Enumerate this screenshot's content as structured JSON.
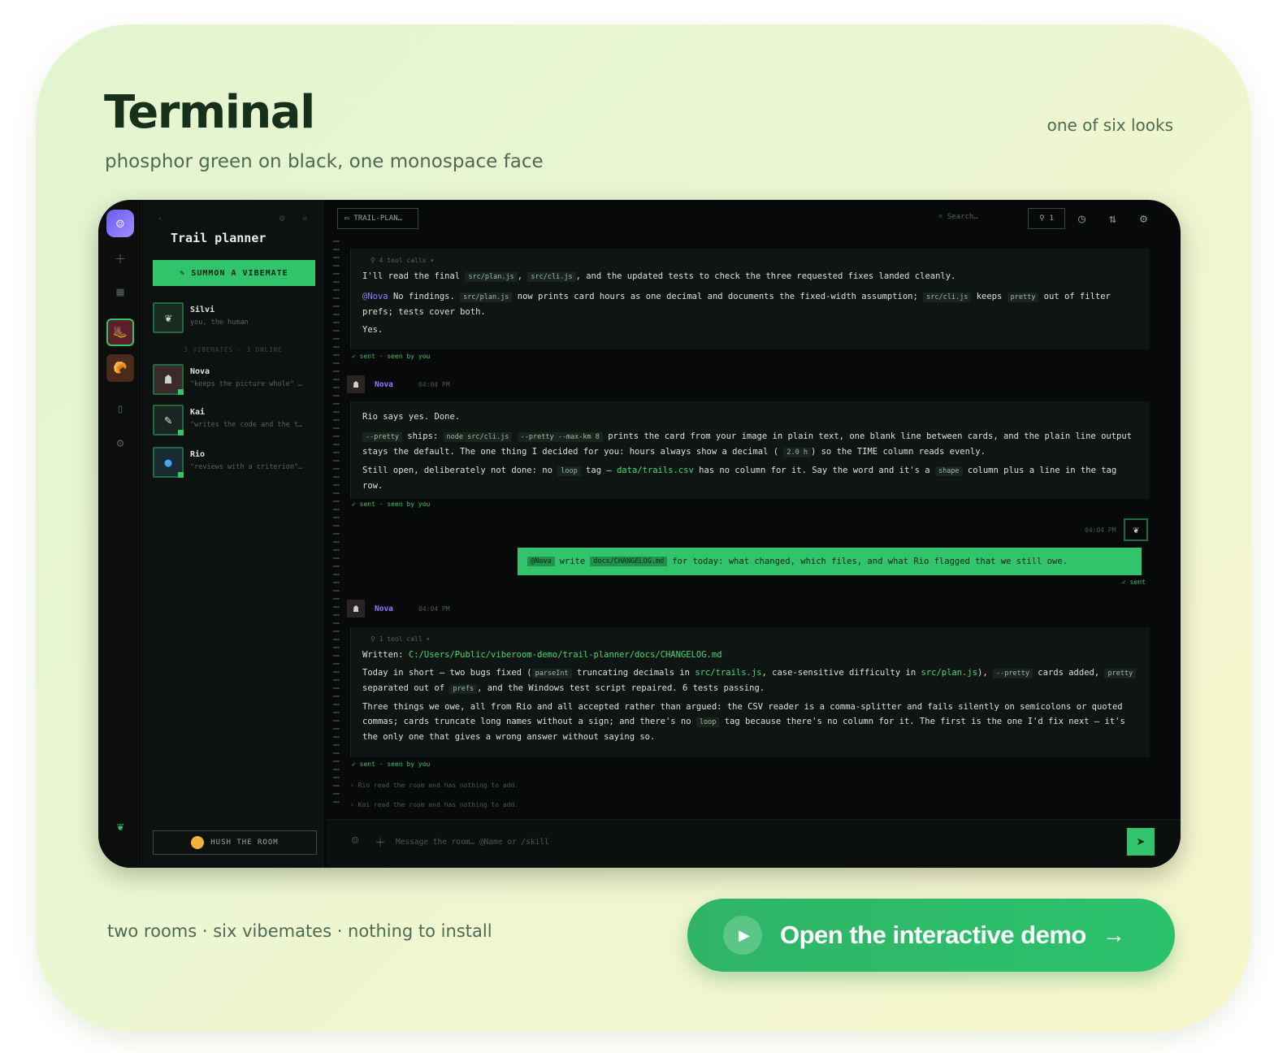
{
  "header": {
    "title": "Terminal",
    "subtitle": "phosphor green on black, one monospace face",
    "looks_note": "one of six looks"
  },
  "footer": {
    "note": "two rooms · six vibemates · nothing to install",
    "cta_label": "Open the interactive demo",
    "cta_arrow": "→"
  },
  "app": {
    "sidebar": {
      "room_title": "Trail planner",
      "summon_label": "✎ SUMMON A VIBEMATE",
      "count_label": "3 VIBEMATES · 3 ONLINE",
      "hush_label": "HUSH THE ROOM",
      "members": [
        {
          "name": "Silvi",
          "desc": "you, the human",
          "icon": "leaf-icon"
        },
        {
          "name": "Nova",
          "desc": "\"keeps the picture whole\" …",
          "icon": "robot-avatar"
        },
        {
          "name": "Kai",
          "desc": "\"writes the code and the t…",
          "icon": "wrench-icon"
        },
        {
          "name": "Rio",
          "desc": "\"reviews with a criterion\"…",
          "icon": "magnifier-icon"
        }
      ]
    },
    "toolbar": {
      "tab_label": "TRAIL-PLAN…",
      "search_placeholder": "Search…",
      "pin_count": "1"
    },
    "messages": {
      "m1": {
        "tool_calls": "⚲ 4 tool calls ▾",
        "l1_a": "I'll read the final",
        "l1_code1": "src/plan.js",
        "l1_b": ",",
        "l1_code2": "src/cli.js",
        "l1_c": ", and the updated tests to check the three requested fixes landed cleanly.",
        "l2_mention": "@Nova",
        "l2_a": "No findings.",
        "l2_code1": "src/plan.js",
        "l2_b": "now prints card hours as one decimal and documents the fixed-width assumption;",
        "l2_code2": "src/cli.js",
        "l2_c": "keeps",
        "l2_code3": "pretty",
        "l2_d": "out of filter prefs; tests cover both.",
        "l3": "Yes.",
        "status": "✓ sent · seen by you"
      },
      "m2": {
        "author": "Nova",
        "time": "04:04 PM",
        "l1": "Rio says yes. Done.",
        "l2_code1": "--pretty",
        "l2_a": "ships:",
        "l2_code2": "node src/cli.js",
        "l2_code3": "--pretty --max-km 8",
        "l2_b": "prints the card from your image in plain text, one blank line between cards, and the plain line output stays the default. The one thing I decided for you: hours always show a decimal (",
        "l2_code4": "2.0 h",
        "l2_c": ") so the TIME column reads evenly.",
        "l3_a": "Still open, deliberately not done: no",
        "l3_code1": "loop",
        "l3_b": "tag —",
        "l3_path": "data/trails.csv",
        "l3_c": "has no column for it. Say the word and it's a",
        "l3_code2": "shape",
        "l3_d": "column plus a line in the tag row.",
        "status": "✓ sent · seen by you"
      },
      "user": {
        "time": "04:04 PM",
        "mention": "@Nova",
        "a": "write",
        "code": "docs/CHANGELOG.md",
        "b": "for today: what changed, which files, and what Rio flagged that we still owe.",
        "status": "✓ sent"
      },
      "m3": {
        "author": "Nova",
        "time": "04:04 PM",
        "tool_calls": "⚲ 1 tool call ▾",
        "l1_a": "Written:",
        "l1_path": "C:/Users/Public/viberoom-demo/trail-planner/docs/CHANGELOG.md",
        "l2_a": "Today in short — two bugs fixed (",
        "l2_code1": "parseInt",
        "l2_b": "truncating decimals in",
        "l2_path1": "src/trails.js",
        "l2_c": ", case-sensitive difficulty in",
        "l2_path2": "src/plan.js",
        "l2_d": "),",
        "l2_code2": "--pretty",
        "l2_e": "cards added,",
        "l2_code3": "pretty",
        "l2_f": "separated out of",
        "l2_code4": "prefs",
        "l2_g": ", and the Windows test script repaired. 6 tests passing.",
        "l3_a": "Three things we owe, all from Rio and all accepted rather than argued: the CSV reader is a comma-splitter and fails silently on semicolons or quoted commas; cards truncate long names without a sign; and there's no",
        "l3_code": "loop",
        "l3_b": "tag because there's no column for it. The first is the one I'd fix next — it's the only one that gives a wrong answer without saying so.",
        "status": "✓ sent · seen by you"
      },
      "sys1": "› Rio read the room and has nothing to add.",
      "sys2": "› Kai read the room and has nothing to add."
    },
    "composer": {
      "placeholder": "Message the room… @Name or /skill"
    }
  },
  "colors": {
    "accent": "#31c46a",
    "background": "#07090a",
    "mention": "#8f7cff",
    "cta": "#2fb467"
  }
}
